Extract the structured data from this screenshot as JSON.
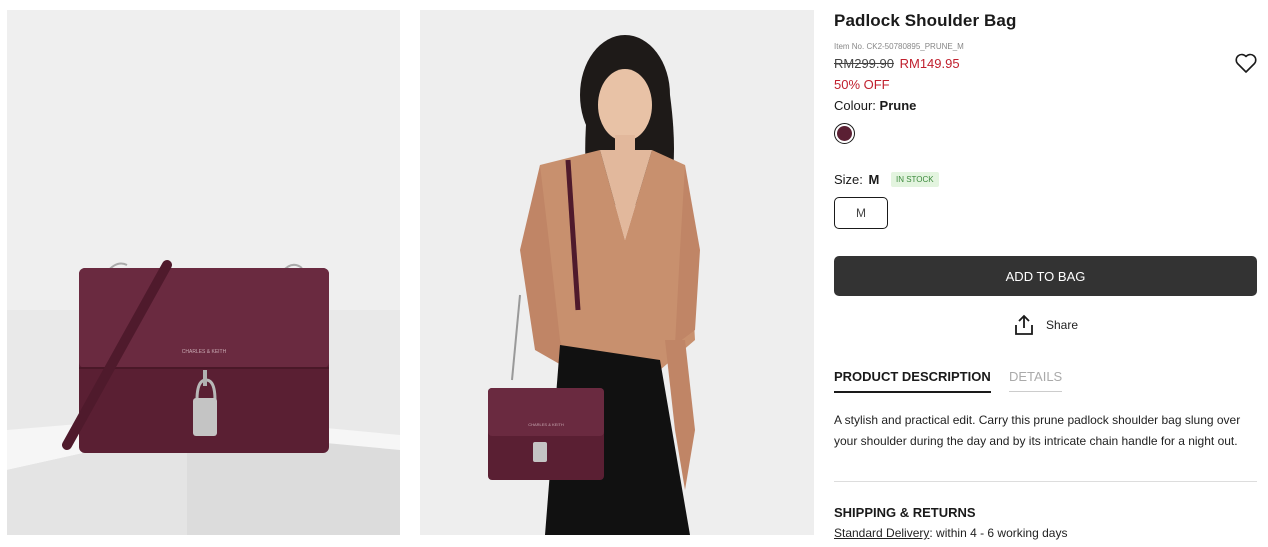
{
  "product": {
    "title": "Padlock Shoulder Bag",
    "item_no": "Item No. CK2-50780895_PRUNE_M",
    "old_price": "RM299.90",
    "new_price": "RM149.95",
    "discount": "50% OFF",
    "colour_label": "Colour:",
    "colour_value": "Prune",
    "size_label": "Size:",
    "size_value": "M",
    "stock_badge": "IN STOCK",
    "size_option": "M",
    "add_to_bag": "ADD TO BAG",
    "share": "Share"
  },
  "tabs": [
    {
      "label": "PRODUCT DESCRIPTION"
    },
    {
      "label": "DETAILS"
    }
  ],
  "description": "A stylish and practical edit. Carry this prune padlock shoulder bag slung over your shoulder during the day and by its intricate chain handle for a night out.",
  "shipping": {
    "title": "SHIPPING & RETURNS",
    "delivery_link": "Standard Delivery",
    "delivery_text": ": within 4 - 6 working days"
  },
  "colors": {
    "prune": "#5a1f33",
    "sale": "#c0202e",
    "button": "#333333",
    "stock_bg": "#e3f4df"
  },
  "icons": [
    "heart-icon",
    "share-icon"
  ]
}
